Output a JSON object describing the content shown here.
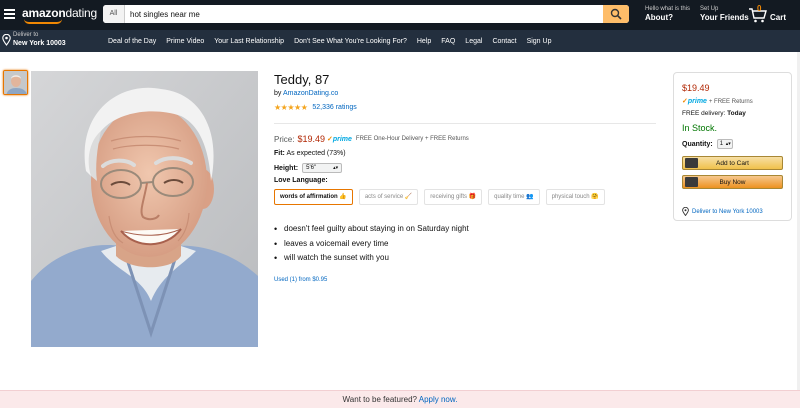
{
  "header": {
    "logo_bold": "amazon",
    "logo_light": "dating",
    "search_category": "All",
    "search_value": "hot singles near me",
    "about_small": "Hello what is this",
    "about_big": "About?",
    "account_small": "Set Up",
    "account_big": "Your Friends",
    "cart_count": "0",
    "cart_label": "Cart"
  },
  "nav": {
    "deliver_small": "Deliver to",
    "deliver_big": "New York 10003",
    "links": [
      "Deal of the Day",
      "Prime Video",
      "Your Last Relationship",
      "Don't See What You're Looking For?",
      "Help",
      "FAQ",
      "Legal",
      "Contact",
      "Sign Up"
    ]
  },
  "product": {
    "title": "Teddy, 87",
    "by_prefix": "by",
    "by_link": "AmazonDating.co",
    "stars": "★★★★★",
    "rating_count": "52,336 ratings",
    "rating_fraction": 1.0,
    "price_label": "Price:",
    "price": "$19.49",
    "prime_label": "prime",
    "prime_note": "FREE One-Hour Delivery + FREE Returns",
    "fit_label": "Fit:",
    "fit_value": "As expected (73%)",
    "height_label": "Height:",
    "height_value": "5'6\"",
    "love_label": "Love Language:",
    "love_options": [
      "words of affirmation 👍",
      "acts of service 🧹",
      "receiving gifts 🎁",
      "quality time 👥",
      "physical touch 🤗"
    ],
    "bullets": [
      "doesn't feel guilty about staying in on Saturday night",
      "leaves a voicemail every time",
      "will watch the sunset with you"
    ],
    "used": "Used (1) from $0.95"
  },
  "buybox": {
    "price": "$19.49",
    "prime": "prime",
    "prime_note": "+ FREE Returns",
    "delivery_prefix": "FREE delivery:",
    "delivery_day": "Today",
    "stock": "In Stock.",
    "qty_label": "Quantity:",
    "qty_value": "1",
    "add_to_cart": "Add to Cart",
    "buy_now": "Buy Now",
    "deliver_to": "Deliver to New York 10003"
  },
  "banner": {
    "text": "Want to be featured?",
    "link": "Apply now."
  },
  "colors": {
    "header_bg": "#131a22",
    "nav_bg": "#232f3e",
    "accent_orange": "#f08804",
    "price_red": "#b12704",
    "link_blue": "#0066c0",
    "stock_green": "#007600",
    "prime_blue": "#00a8e1"
  }
}
